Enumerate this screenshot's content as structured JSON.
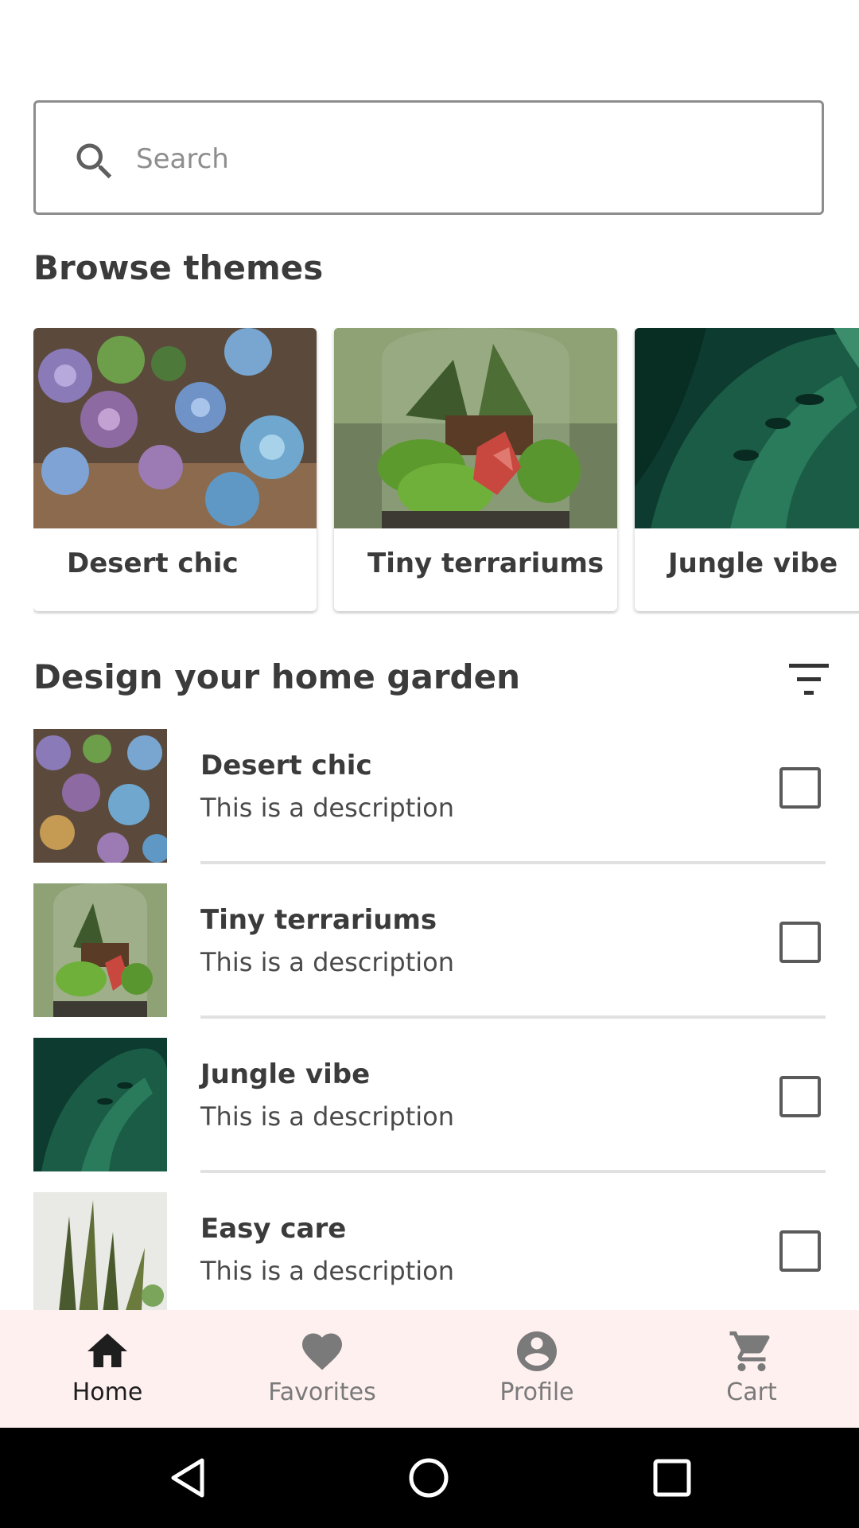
{
  "search": {
    "placeholder": "Search",
    "value": ""
  },
  "browse": {
    "title": "Browse themes",
    "cards": [
      {
        "label": "Desert chic"
      },
      {
        "label": "Tiny terrariums"
      },
      {
        "label": "Jungle vibe"
      }
    ]
  },
  "design": {
    "title": "Design your home garden",
    "items": [
      {
        "title": "Desert chic",
        "description": "This is a description",
        "checked": false
      },
      {
        "title": "Tiny terrariums",
        "description": "This is a description",
        "checked": false
      },
      {
        "title": "Jungle vibe",
        "description": "This is a description",
        "checked": false
      },
      {
        "title": "Easy care",
        "description": "This is a description",
        "checked": false
      }
    ]
  },
  "bottom_nav": {
    "active": "home",
    "items": [
      {
        "label": "Home",
        "icon": "home-icon"
      },
      {
        "label": "Favorites",
        "icon": "heart-icon"
      },
      {
        "label": "Profile",
        "icon": "account-circle-icon"
      },
      {
        "label": "Cart",
        "icon": "cart-icon"
      }
    ]
  },
  "colors": {
    "nav_background": "#fff0f0",
    "text_primary": "#3b3b3b",
    "nav_inactive": "#7a7a7a",
    "nav_active": "#1e1e1e"
  }
}
